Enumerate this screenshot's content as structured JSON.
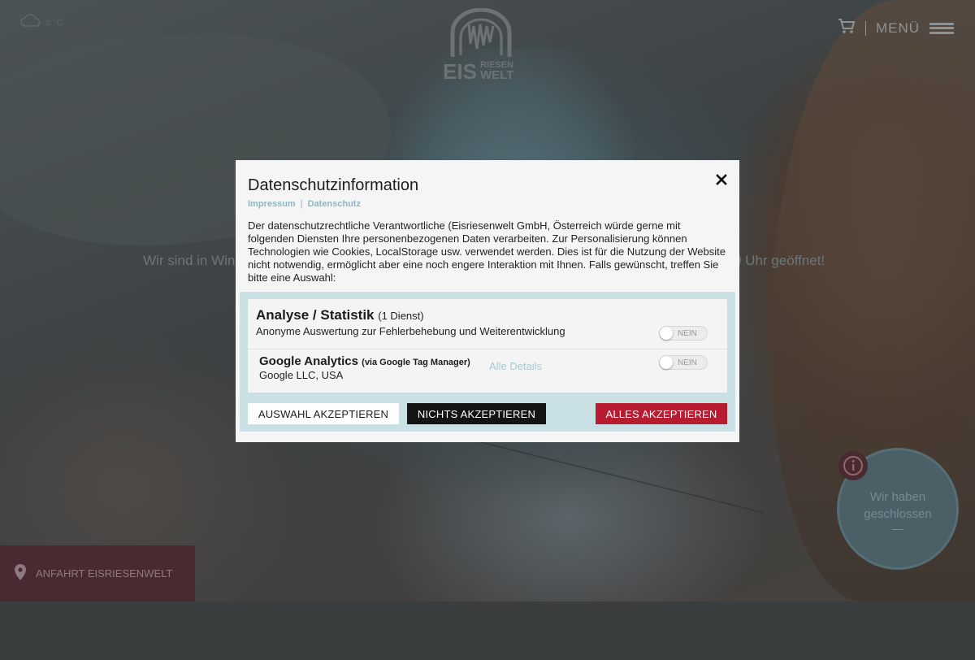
{
  "header": {
    "weather_text": "5 °C",
    "logo_top": "RIESEN",
    "logo_left": "EIS",
    "logo_bottom": "WELT",
    "menu_label": "MENÜ"
  },
  "background": {
    "text_left": "Wir sind in Win",
    "text_right": "0 Uhr geöffnet!"
  },
  "anfahrt": {
    "label": "ANFAHRT EISRIESENWELT"
  },
  "closed_badge": {
    "line1": "Wir haben",
    "line2": "geschlossen"
  },
  "modal": {
    "title": "Datenschutzinformation",
    "links": [
      "Impressum",
      "Datenschutz"
    ],
    "link_separator": "|",
    "description": "Der datenschutzrechtliche Verantwortliche (Eisriesenwelt GmbH, Österreich würde gerne mit folgenden Diensten Ihre personenbezogenen Daten verarbeiten. Zur Personalisierung können Technologien wie Cookies, LocalStorage usw. verwendet werden. Dies ist für die Nutzung der Website nicht notwendig, ermöglicht aber eine noch engere Interaktion mit Ihnen. Falls gewünscht, treffen Sie bitte eine Auswahl:",
    "category": {
      "title": "Analyse / Statistik",
      "count": "(1 Dienst)",
      "description": "Anonyme Auswertung zur Fehlerbehebung und Weiterentwicklung",
      "toggle_label": "NEIN"
    },
    "service": {
      "name": "Google Analytics",
      "via": "(via Google Tag Manager)",
      "vendor": "Google LLC, USA",
      "details_link": "Alle Details",
      "toggle_label": "NEIN"
    },
    "buttons": {
      "accept_selection": "AUSWAHL AKZEPTIEREN",
      "accept_none": "NICHTS AKZEPTIEREN",
      "accept_all": "ALLES AKZEPTIEREN"
    }
  },
  "colors": {
    "accent_red": "#b81c30",
    "panel_blue": "#c9e0e5",
    "link_blue": "#8db7c3"
  }
}
